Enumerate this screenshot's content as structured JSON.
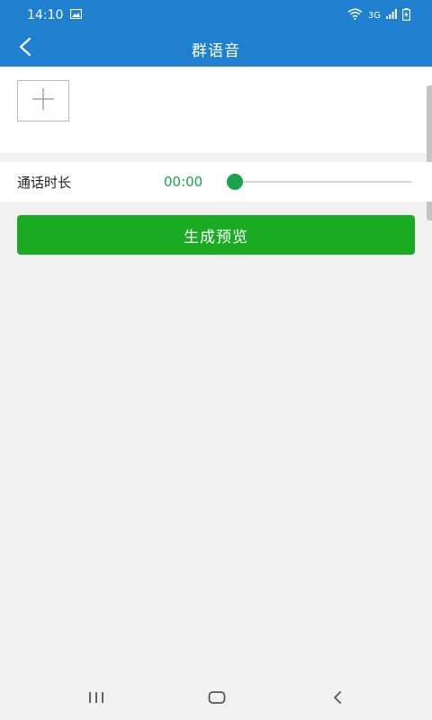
{
  "status_bar": {
    "time": "14:10",
    "network_label": "3G"
  },
  "header": {
    "title": "群语音"
  },
  "duration": {
    "label": "通话时长",
    "value": "00:00",
    "slider_fraction": 0
  },
  "actions": {
    "preview_label": "生成预览"
  },
  "colors": {
    "primary_blue": "#1e80cf",
    "accent_green": "#1aab23",
    "value_green": "#1aa34a"
  },
  "icons": {
    "back": "chevron-left-icon",
    "add": "plus-icon",
    "nav_recents": "recents-icon",
    "nav_home": "home-icon",
    "nav_back": "back-triangle-icon"
  }
}
